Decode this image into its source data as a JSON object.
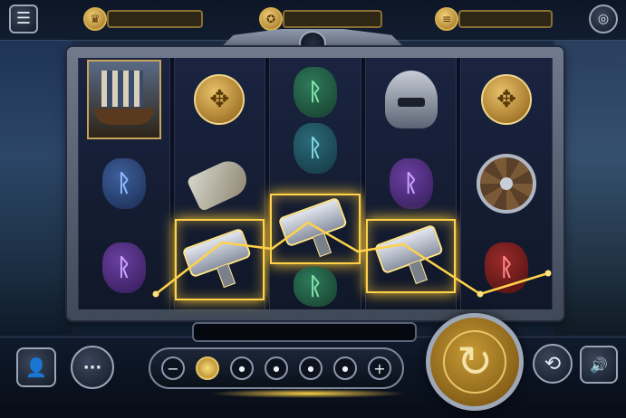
{
  "top_bar": {
    "menu_icon": "hamburger-menu-icon",
    "level_icon": "crown-icon",
    "level_value": "",
    "bonus_icon": "coin-crest-icon",
    "bonus_value": "",
    "coins_icon": "coin-stack-icon",
    "coins_value": "",
    "wallet_icon": "coins-icon"
  },
  "reels": {
    "columns": [
      [
        "viking-ship",
        "blue-rune",
        "purple-rune"
      ],
      [
        "celtic-knot-coin",
        "drinking-horn",
        "thor-hammer"
      ],
      [
        "green-rune",
        "teal-rune",
        "thor-hammer",
        "green-rune"
      ],
      [
        "viking-helmet",
        "purple-rune",
        "thor-hammer"
      ],
      [
        "celtic-knot-coin",
        "viking-shield",
        "red-rune"
      ]
    ],
    "rune_glyph": "ᚱ",
    "winning_symbol": "thor-hammer",
    "payline_color": "#ffd24a"
  },
  "win_display": {
    "value": ""
  },
  "bet_panel": {
    "minus_label": "−",
    "plus_label": "+",
    "levels": 5,
    "active_level": 1
  },
  "bottom": {
    "profile_icon": "user-icon",
    "more_label": "···",
    "spin_icon": "spin-arrow-icon",
    "spin_glyph": "↻",
    "autoplay_icon": "autoplay-arrows-icon",
    "autoplay_glyph": "⟲",
    "sound_icon": "speaker-icon",
    "sound_glyph": "🔊"
  },
  "colors": {
    "gold": "#d7b04f",
    "frame_steel": "#6f7a8c",
    "background_navy": "#1b2a44"
  }
}
